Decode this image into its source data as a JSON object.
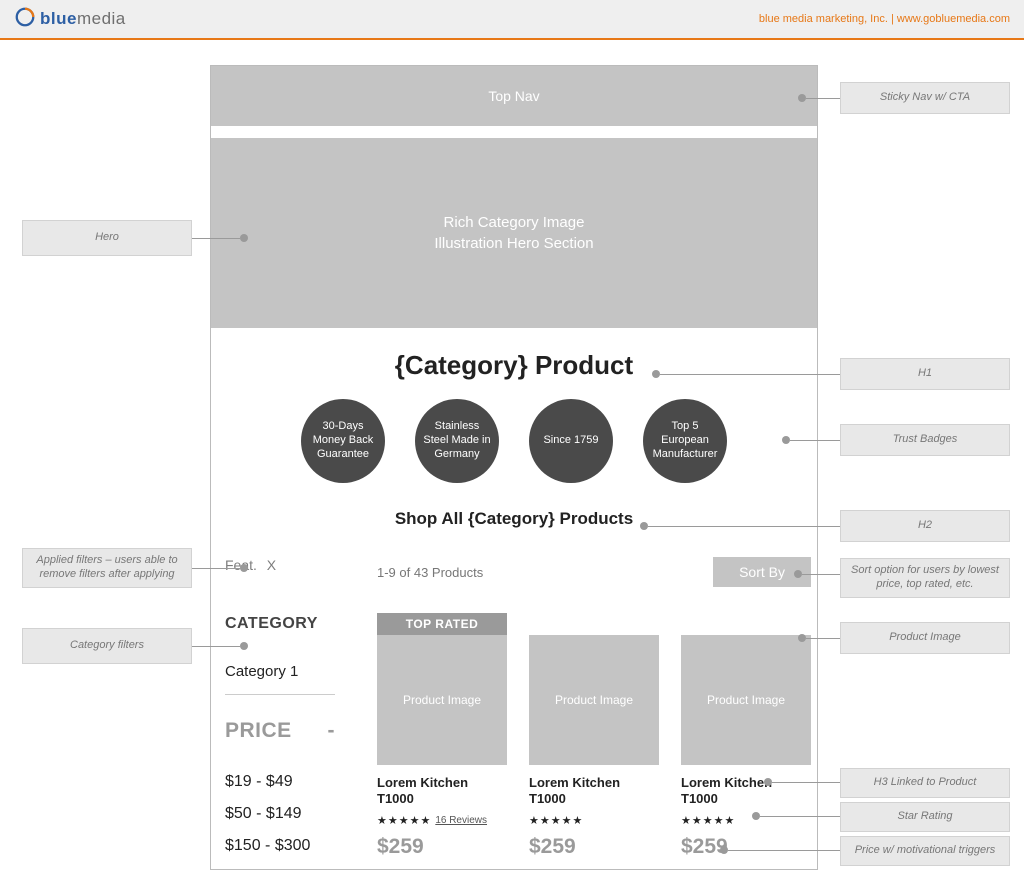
{
  "header": {
    "logo_blue": "blue",
    "logo_media": "media",
    "right_text": "blue media marketing, Inc. | www.gobluemedia.com"
  },
  "wire": {
    "topnav": "Top Nav",
    "hero_l1": "Rich Category Image",
    "hero_l2": "Illustration Hero Section",
    "h1": "{Category} Product",
    "badges": [
      "30-Days Money Back Guarantee",
      "Stainless Steel Made in Germany",
      "Since 1759",
      "Top 5 European Manufacturer"
    ],
    "h2": "Shop All {Category} Products",
    "applied_filter": "Feat.",
    "applied_x": "X",
    "cat_heading": "CATEGORY",
    "cat_item": "Category 1",
    "price_heading": "PRICE",
    "price_collapse": "-",
    "price_ranges": [
      "$19 - $49",
      "$50 - $149",
      "$150 - $300"
    ],
    "result_count": "1-9 of 43 Products",
    "sort": "Sort By",
    "top_rated": "TOP RATED",
    "prod_img": "Product Image",
    "prod_title": "Lorem Kitchen T1000",
    "reviews": "16 Reviews",
    "price": "$259"
  },
  "ann": {
    "hero": "Hero",
    "applied_filters": "Applied filters – users able to remove filters after applying",
    "cat_filters": "Category filters",
    "sticky": "Sticky Nav w/ CTA",
    "h1": "H1",
    "trust": "Trust Badges",
    "h2": "H2",
    "sort": "Sort option for users by lowest price, top rated, etc.",
    "prod_img": "Product Image",
    "h3": "H3 Linked to Product",
    "stars": "Star Rating",
    "pricemot": "Price w/ motivational triggers"
  }
}
